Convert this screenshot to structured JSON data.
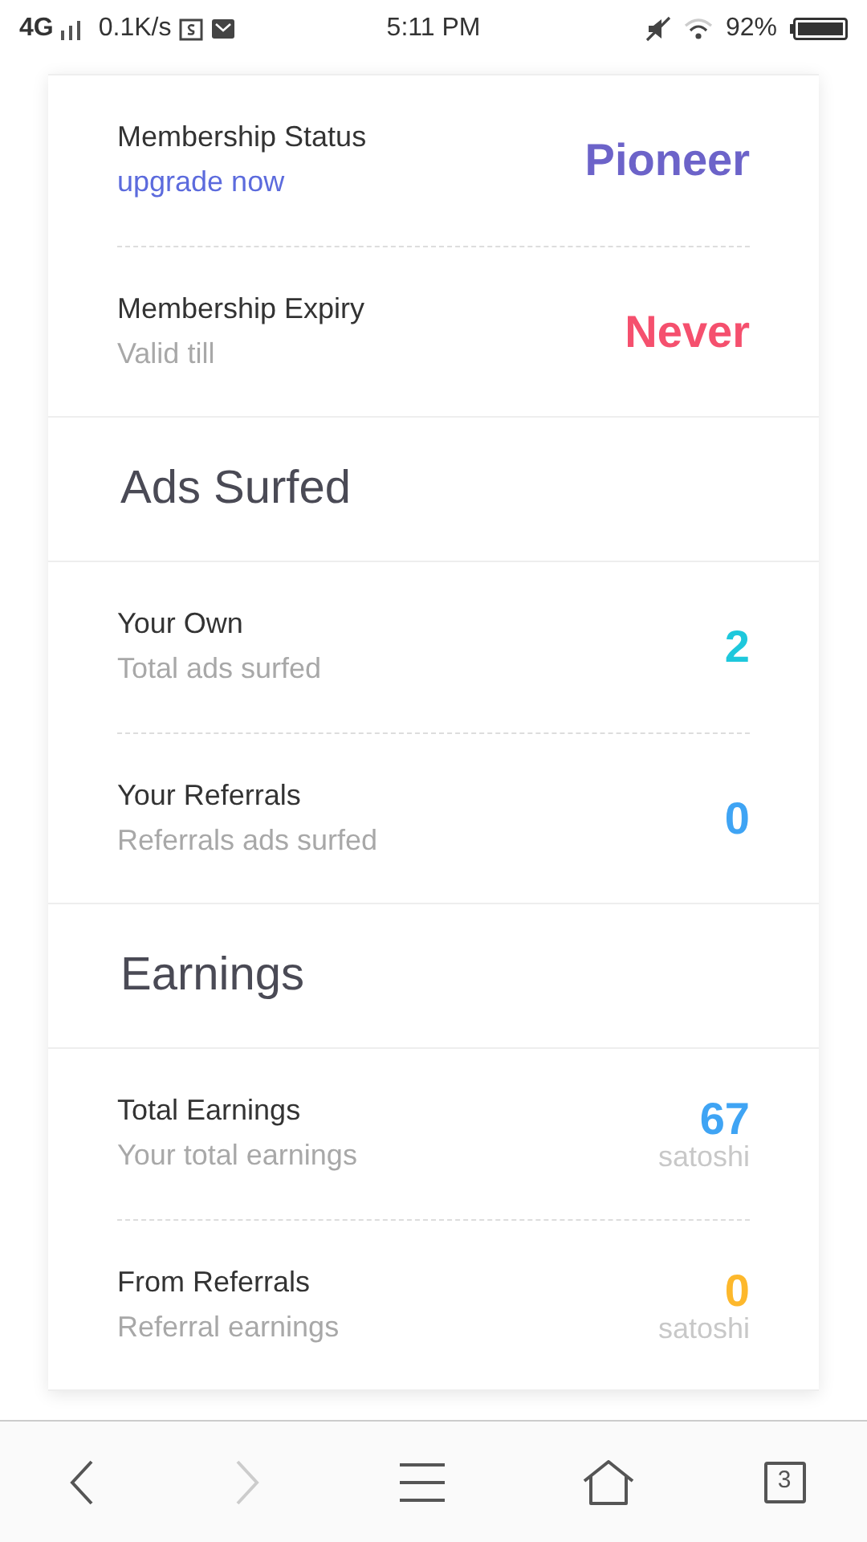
{
  "status_bar": {
    "network": "4G",
    "speed": "0.1K/s",
    "time": "5:11 PM",
    "battery": "92%"
  },
  "sections": [
    {
      "kind": "rows",
      "rows": [
        {
          "label": "Membership Status",
          "sublabel": "upgrade now",
          "sub_link": true,
          "value": "Pioneer",
          "color": "#6c63c9"
        },
        {
          "label": "Membership Expiry",
          "sublabel": "Valid till",
          "sub_link": false,
          "value": "Never",
          "color": "#f5506e"
        }
      ]
    },
    {
      "kind": "header",
      "title": "Ads Surfed"
    },
    {
      "kind": "rows",
      "rows": [
        {
          "label": "Your Own",
          "sublabel": "Total ads surfed",
          "sub_link": false,
          "value": "2",
          "color": "#1ec8dc"
        },
        {
          "label": "Your Referrals",
          "sublabel": "Referrals ads surfed",
          "sub_link": false,
          "value": "0",
          "color": "#3fa4f4"
        }
      ]
    },
    {
      "kind": "header",
      "title": "Earnings"
    },
    {
      "kind": "rows",
      "rows": [
        {
          "label": "Total Earnings",
          "sublabel": "Your total earnings",
          "sub_link": false,
          "value": "67",
          "unit": "satoshi",
          "color": "#3fa4f4"
        },
        {
          "label": "From Referrals",
          "sublabel": "Referral earnings",
          "sub_link": false,
          "value": "0",
          "unit": "satoshi",
          "color": "#fdb82c"
        }
      ]
    }
  ],
  "bottom_nav": {
    "back_disabled": false,
    "forward_disabled": true,
    "tab_count": "3"
  }
}
